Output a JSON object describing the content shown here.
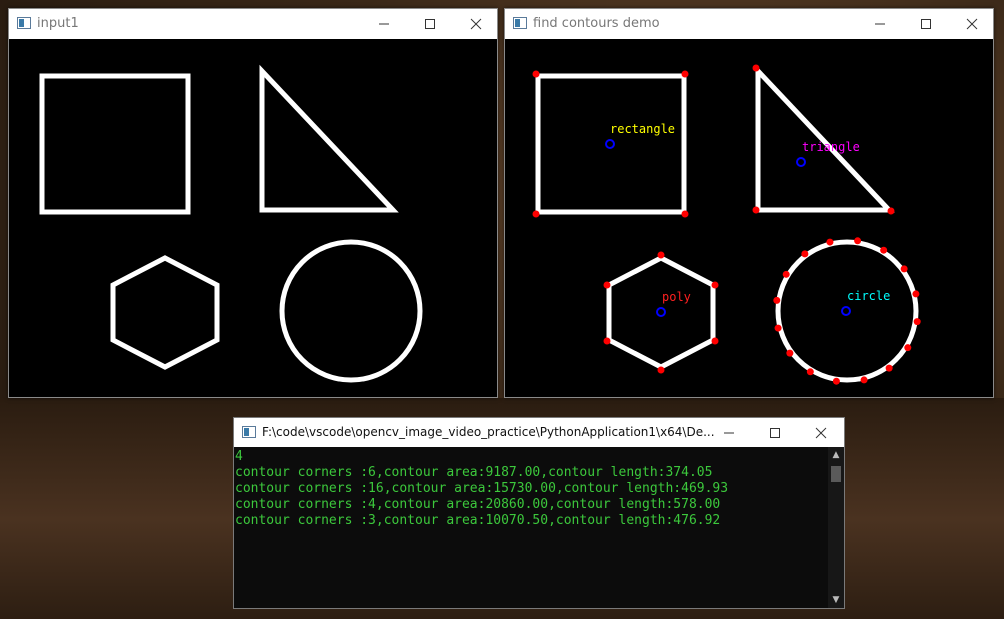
{
  "windows": {
    "input": {
      "title": "input1"
    },
    "demo": {
      "title": "find contours demo",
      "labels": {
        "rectangle": "rectangle",
        "triangle": "triangle",
        "poly": "poly",
        "circle": "circle"
      },
      "label_colors": {
        "rectangle": "#ffff00",
        "triangle": "#ff00ff",
        "poly": "#ff2020",
        "circle": "#00ffff"
      },
      "corner_color": "#ff0000",
      "center_color": "#0000ff"
    },
    "console": {
      "title": "F:\\code\\vscode\\opencv_image_video_practice\\PythonApplication1\\x64\\De...",
      "lines": [
        "4",
        "contour corners :6,contour area:9187.00,contour length:374.05",
        "contour corners :16,contour area:15730.00,contour length:469.93",
        "contour corners :4,contour area:20860.00,contour length:578.00",
        "contour corners :3,contour area:10070.50,contour length:476.92"
      ],
      "text_color": "#3cc83c"
    }
  },
  "icons": {
    "minimize": "minimize-icon",
    "maximize": "maximize-icon",
    "close": "close-icon",
    "app": "window-app-icon"
  }
}
